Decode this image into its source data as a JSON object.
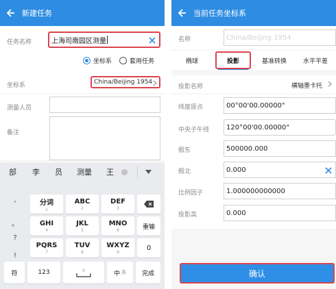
{
  "left": {
    "title": "新建任务",
    "task_name_label": "任务名称",
    "task_name_value": "上海司南园区测量",
    "radio_coord": "坐标系",
    "radio_apply": "套用任务",
    "coord_label": "坐标系",
    "coord_value": "China/Beijing 1954",
    "surveyor_label": "测量人员",
    "note_label": "备注",
    "candidates": [
      "部",
      "李",
      "员",
      "测量",
      "王"
    ],
    "side_keys": [
      "'",
      "。",
      "?",
      "!"
    ],
    "keys": [
      {
        "main": "分词",
        "sub": "1"
      },
      {
        "main": "ABC",
        "sub": "2"
      },
      {
        "main": "DEF",
        "sub": "3"
      },
      {
        "main": "GHI",
        "sub": "4"
      },
      {
        "main": "JKL",
        "sub": "5"
      },
      {
        "main": "MNO",
        "sub": "6"
      },
      {
        "main": "PQRS",
        "sub": "7"
      },
      {
        "main": "TUV",
        "sub": "8"
      },
      {
        "main": "WXYZ",
        "sub": "9"
      }
    ],
    "key_reset": "重输",
    "key_zero": "0",
    "bottom_keys": {
      "sym": "符",
      "num": "123",
      "space_sub": "0",
      "lang": "中",
      "lang_sub": "英",
      "done": "完成"
    }
  },
  "right": {
    "title": "当前任务坐标系",
    "name_label": "名称",
    "name_value": "China/Beijing 1954",
    "tabs": [
      "椭球",
      "投影",
      "基准转换",
      "水平平差"
    ],
    "proj_name_label": "投影名称",
    "proj_name_value": "横轴墨卡托",
    "fields": [
      {
        "label": "纬度原点",
        "value": "00°00'00.00000\""
      },
      {
        "label": "中央子午线",
        "value": "120°00'00.00000\""
      },
      {
        "label": "假东",
        "value": "500000.000"
      },
      {
        "label": "假北",
        "value": "0.000"
      },
      {
        "label": "比例因子",
        "value": "1.000000000000"
      },
      {
        "label": "投影高",
        "value": "0.000"
      }
    ],
    "confirm": "确认"
  },
  "colors": {
    "accent": "#2e8de2",
    "highlight": "#d9434f"
  }
}
